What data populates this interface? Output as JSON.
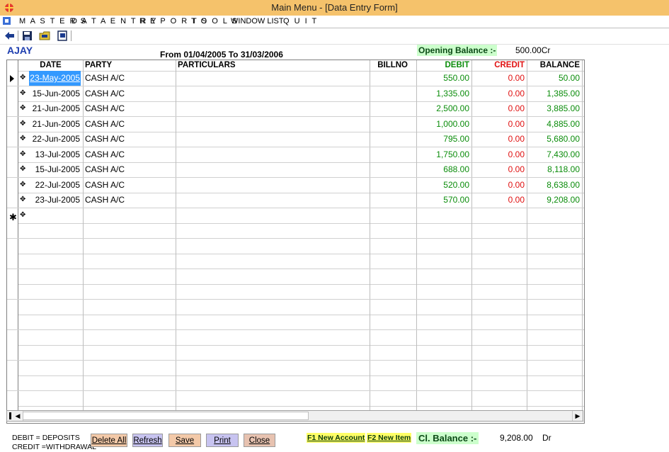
{
  "window": {
    "title": "Main Menu - [Data Entry Form]"
  },
  "menu": [
    "M A S T E R S",
    "D A T A   E N T R Y",
    "R E P O R T S",
    "T O O L S",
    "WINDOW LIST",
    "Q U I T"
  ],
  "toolbar": [
    "back-arrow-icon",
    "save-disk-icon",
    "folder-icon",
    "export-icon"
  ],
  "account": {
    "name": "AJAY",
    "period": "From 01/04/2005 To 31/03/2006",
    "opening_label": "Opening Balance :-",
    "opening_value": "500.00Cr"
  },
  "grid": {
    "headers": [
      "DATE",
      "PARTY",
      "PARTICULARS",
      "BILLNO",
      "DEBIT",
      "CREDIT",
      "BALANCE"
    ],
    "rows": [
      {
        "date": "23-May-2005",
        "party": "CASH A/C",
        "debit": "550.00",
        "credit": "0.00",
        "balance": "50.00"
      },
      {
        "date": "15-Jun-2005",
        "party": "CASH A/C",
        "debit": "1,335.00",
        "credit": "0.00",
        "balance": "1,385.00"
      },
      {
        "date": "21-Jun-2005",
        "party": "CASH A/C",
        "debit": "2,500.00",
        "credit": "0.00",
        "balance": "3,885.00"
      },
      {
        "date": "21-Jun-2005",
        "party": "CASH A/C",
        "debit": "1,000.00",
        "credit": "0.00",
        "balance": "4,885.00"
      },
      {
        "date": "22-Jun-2005",
        "party": "CASH A/C",
        "debit": "795.00",
        "credit": "0.00",
        "balance": "5,680.00"
      },
      {
        "date": "13-Jul-2005",
        "party": "CASH A/C",
        "debit": "1,750.00",
        "credit": "0.00",
        "balance": "7,430.00"
      },
      {
        "date": "15-Jul-2005",
        "party": "CASH A/C",
        "debit": "688.00",
        "credit": "0.00",
        "balance": "8,118.00"
      },
      {
        "date": "22-Jul-2005",
        "party": "CASH A/C",
        "debit": "520.00",
        "credit": "0.00",
        "balance": "8,638.00"
      },
      {
        "date": "23-Jul-2005",
        "party": "CASH A/C",
        "debit": "570.00",
        "credit": "0.00",
        "balance": "9,208.00"
      }
    ]
  },
  "footer": {
    "legend_1": "DEBIT = DEPOSITS",
    "legend_2": "CREDIT =WITHDRAWAL",
    "buttons": [
      "Delete All",
      "Refresh",
      "Save",
      "Print",
      "Close"
    ],
    "f1": "F1 New Account",
    "f2": "F2 New Item",
    "closing_label": "Cl. Balance :-",
    "closing_value": "9,208.00",
    "closing_type": "Dr"
  },
  "colors": {
    "titlebar": "#f5c26b",
    "debit": "#0a8c0a",
    "credit": "#e01010",
    "account": "#1f3fb0"
  }
}
